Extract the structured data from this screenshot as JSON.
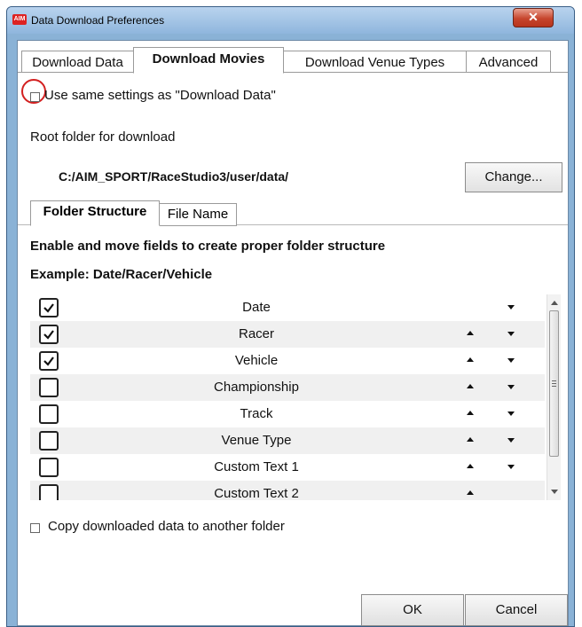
{
  "window": {
    "title": "Data Download Preferences",
    "app_icon_text": "AIM",
    "close_glyph": "✕"
  },
  "tabs": [
    {
      "label": "Download Data"
    },
    {
      "label": "Download Movies"
    },
    {
      "label": "Download Venue Types"
    },
    {
      "label": "Advanced"
    }
  ],
  "active_tab": "Download Movies",
  "same_settings": {
    "label": "Use same settings as \"Download Data\"",
    "checked": false
  },
  "root_folder": {
    "label": "Root folder for download",
    "path": "C:/AIM_SPORT/RaceStudio3/user/data/",
    "change_label": "Change..."
  },
  "sub_tabs": [
    {
      "label": "Folder Structure"
    },
    {
      "label": "File Name"
    }
  ],
  "active_sub_tab": "Folder Structure",
  "instructions": "Enable and move fields to create proper folder structure",
  "example": "Example: Date/Racer/Vehicle",
  "fields": [
    {
      "label": "Date",
      "checked": true,
      "can_up": false,
      "can_down": true
    },
    {
      "label": "Racer",
      "checked": true,
      "can_up": true,
      "can_down": true
    },
    {
      "label": "Vehicle",
      "checked": true,
      "can_up": true,
      "can_down": true
    },
    {
      "label": "Championship",
      "checked": false,
      "can_up": true,
      "can_down": true
    },
    {
      "label": "Track",
      "checked": false,
      "can_up": true,
      "can_down": true
    },
    {
      "label": "Venue Type",
      "checked": false,
      "can_up": true,
      "can_down": true
    },
    {
      "label": "Custom Text 1",
      "checked": false,
      "can_up": true,
      "can_down": true
    },
    {
      "label": "Custom Text 2",
      "checked": false,
      "can_up": true,
      "can_down": false
    }
  ],
  "copy_option": {
    "label": "Copy downloaded data to another folder",
    "checked": false
  },
  "buttons": {
    "ok": "OK",
    "cancel": "Cancel"
  },
  "icons": {
    "app": "aim-logo-icon",
    "close": "close-icon",
    "check": "checkmark-icon",
    "up": "arrow-up-icon",
    "down": "arrow-down-icon"
  },
  "colors": {
    "title_bar": "#8fb6dd",
    "close_button": "#c6452d",
    "highlight_circle": "#d32020",
    "row_shade": "#f0f0f0"
  }
}
